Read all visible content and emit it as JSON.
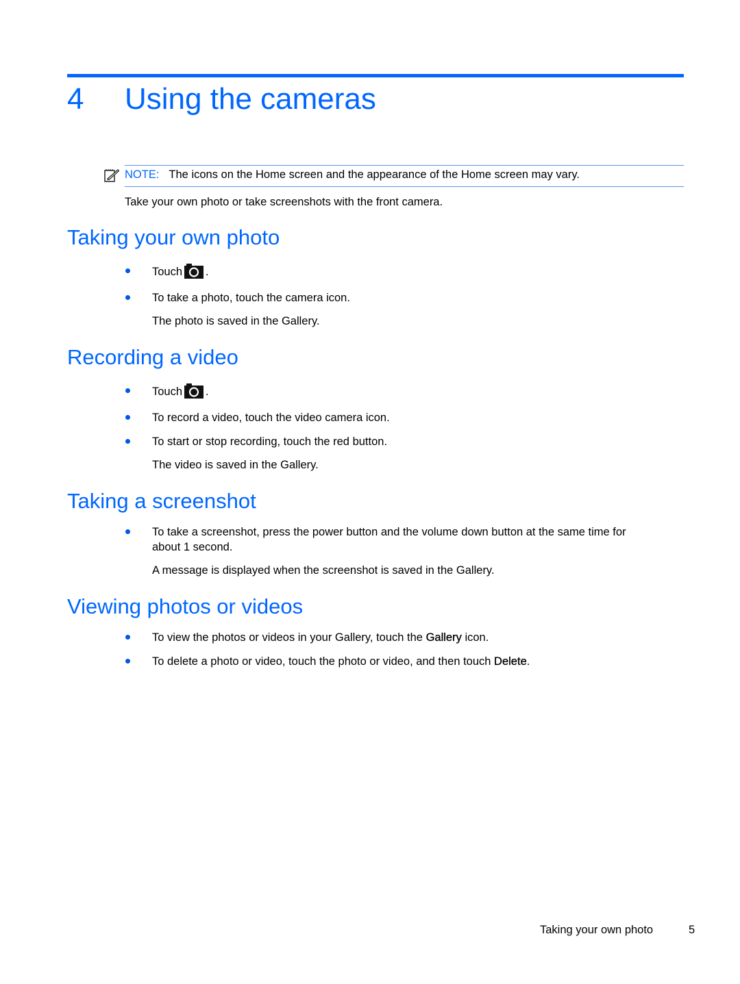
{
  "chapter": {
    "number": "4",
    "title": "Using the cameras"
  },
  "note": {
    "icon": "note-pencil-icon",
    "label": "NOTE:",
    "text": "The icons on the Home screen and the appearance of the Home screen may vary."
  },
  "intro": "Take your own photo or take screenshots with the front camera.",
  "sections": {
    "own_photo": {
      "heading": "Taking your own photo",
      "touch_prefix": "Touch",
      "touch_icon": "camera-icon",
      "touch_suffix": ".",
      "bullet_2": "To take a photo, touch the camera icon.",
      "result": "The photo is saved in the Gallery."
    },
    "video": {
      "heading": "Recording a video",
      "touch_prefix": "Touch",
      "touch_icon": "camera-icon",
      "touch_suffix": ".",
      "bullet_2": "To record a video, touch the video camera icon.",
      "bullet_3": "To start or stop recording, touch the red button.",
      "result": "The video is saved in the Gallery."
    },
    "screenshot": {
      "heading": "Taking a screenshot",
      "bullet_1_line_1": "To take a screenshot, press the power button and the volume down button at the same time for",
      "bullet_1_line_2": "about 1 second.",
      "result": "A message is displayed when the screenshot is saved in the Gallery."
    },
    "viewing": {
      "heading": "Viewing photos or videos",
      "bullet_1_pre": "To view the photos or videos in your Gallery, touch the",
      "bullet_1_bold": "Gallery",
      "bullet_1_post": "icon.",
      "bullet_2_pre": "To delete a photo or video, touch the photo or video, and then touch",
      "bullet_2_bold": "Delete",
      "bullet_2_post": "."
    }
  },
  "footer": {
    "section": "Taking your own photo",
    "page_number": "5"
  },
  "colors": {
    "accent": "#0066ff",
    "note_rule": "#5b8ef5"
  }
}
